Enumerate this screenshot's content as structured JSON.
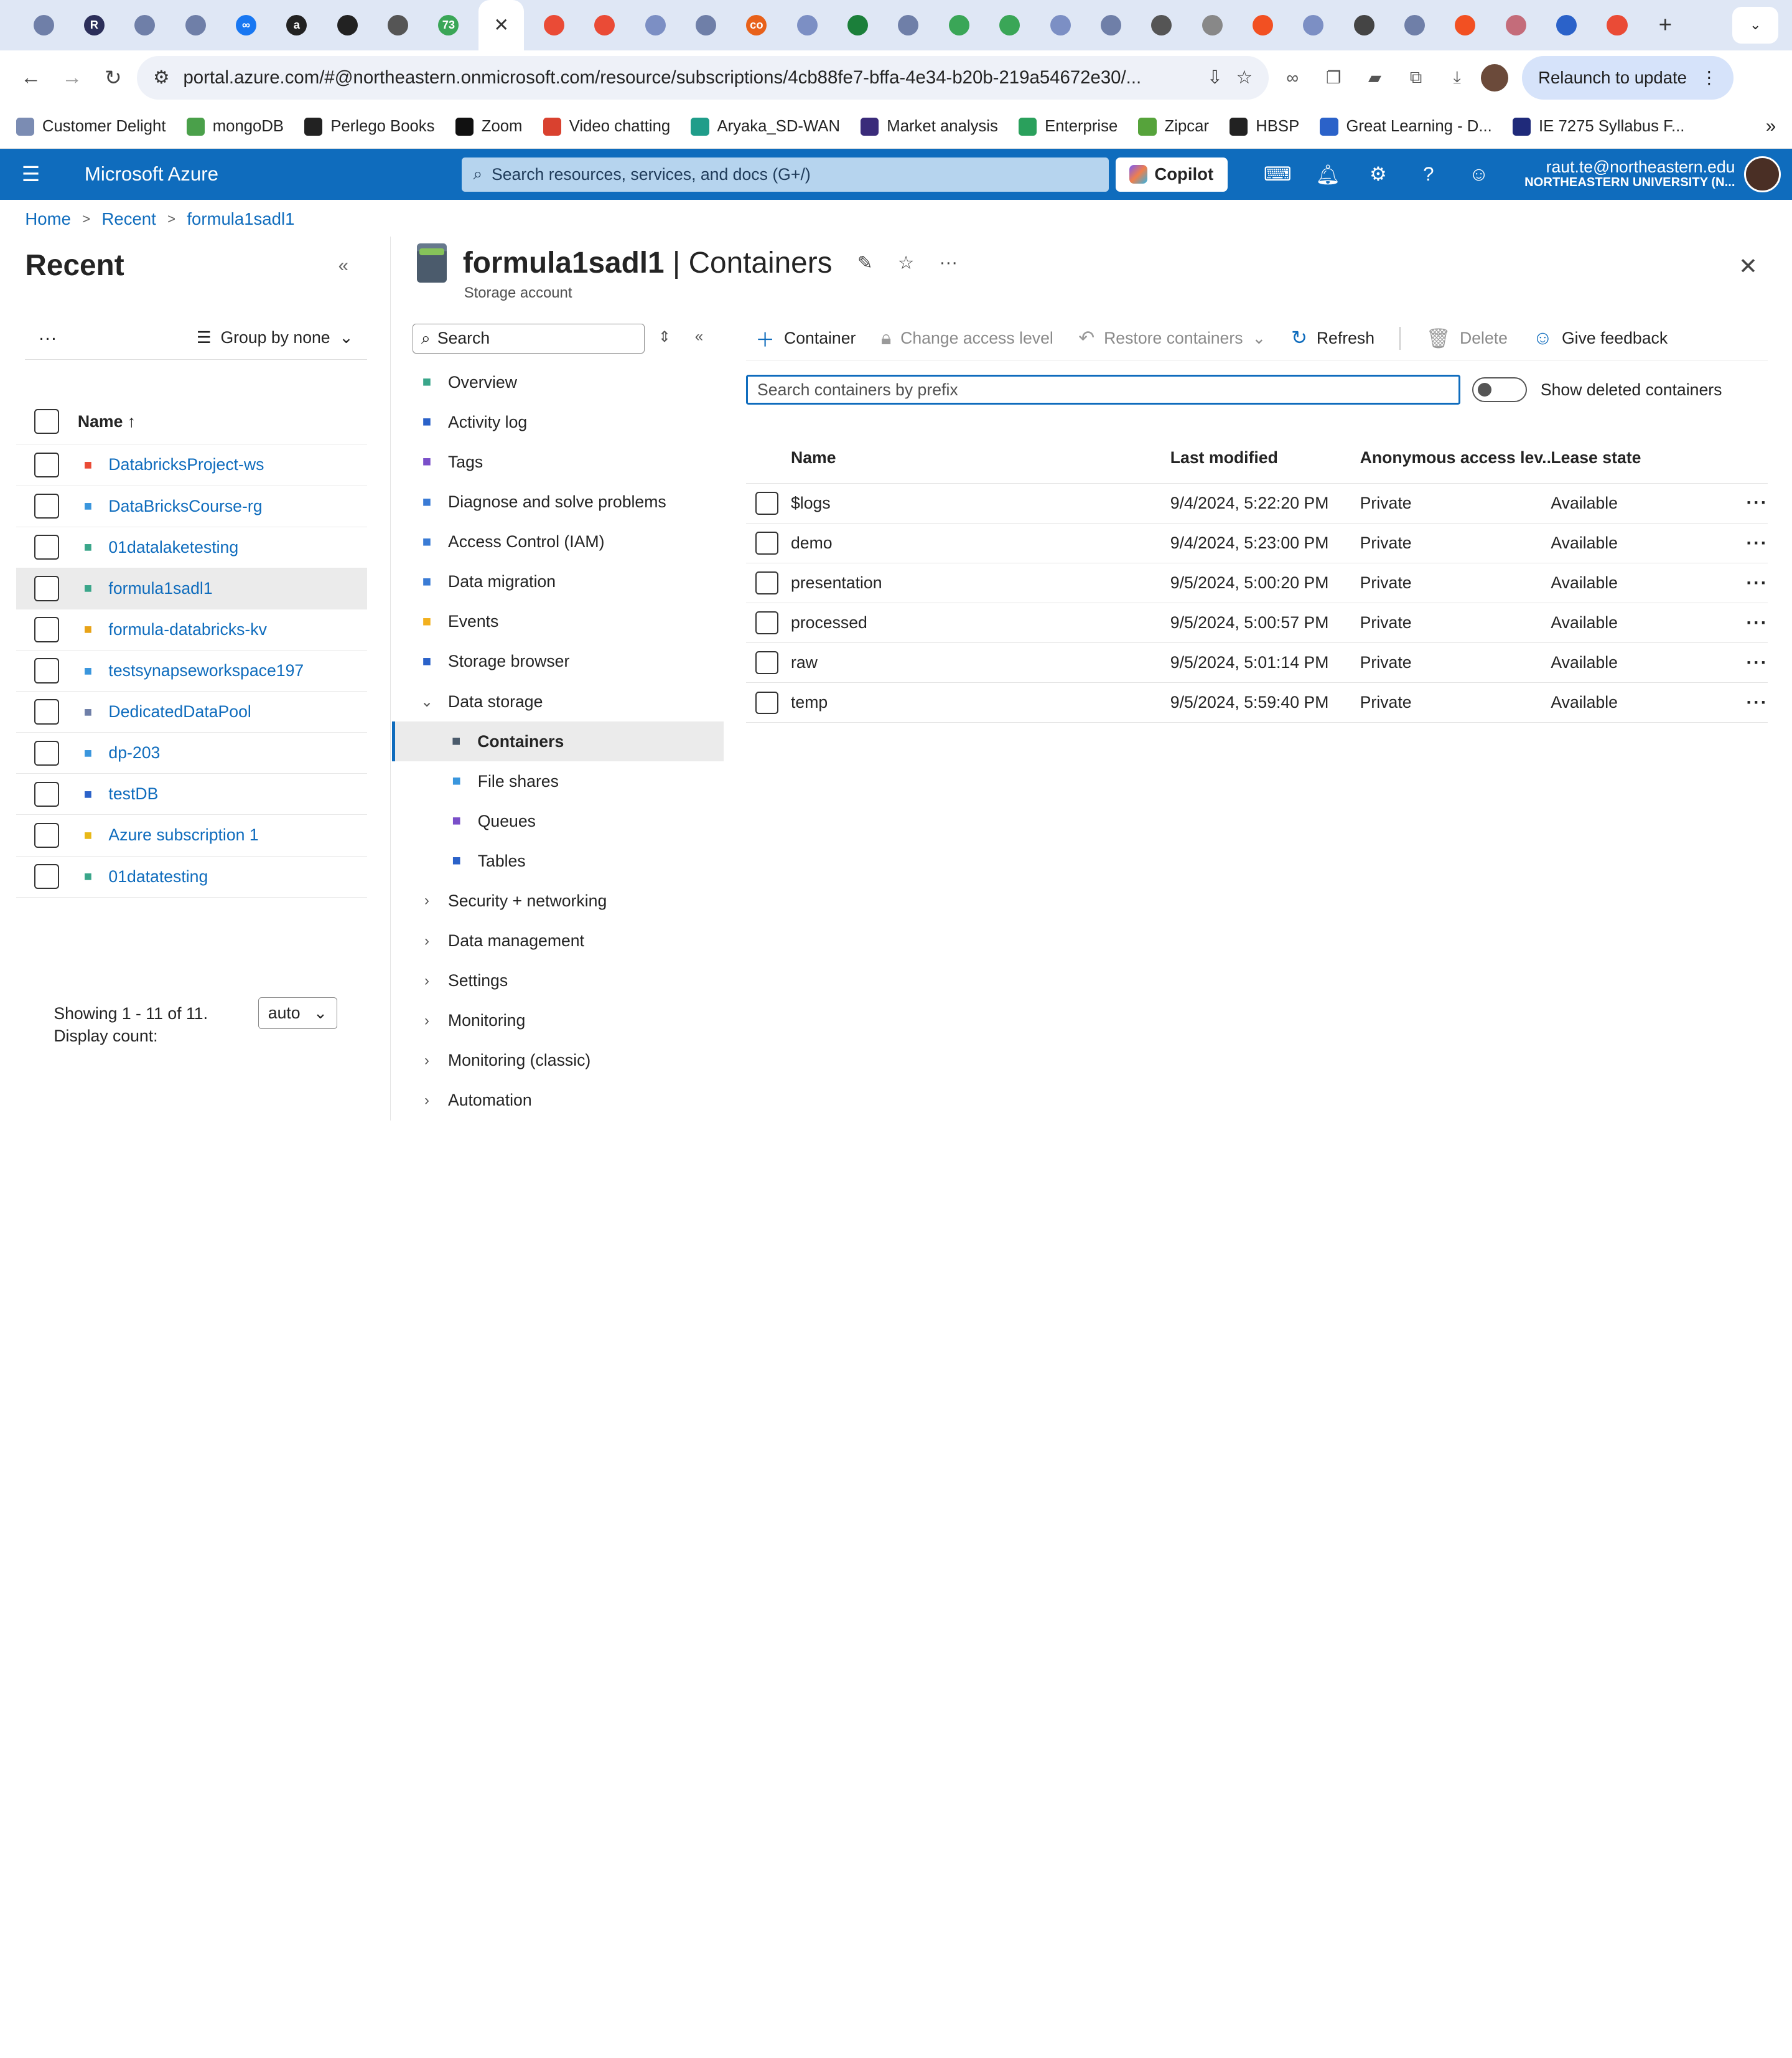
{
  "browser": {
    "tabs": [
      {
        "icon": "chrome-icon",
        "color": "#6f7fa8"
      },
      {
        "icon": "r-app-icon",
        "color": "#2c2f5a",
        "label": "R"
      },
      {
        "icon": "gear-badge-icon",
        "color": "#6f7fa8"
      },
      {
        "icon": "gear-badge-icon",
        "color": "#6f7fa8"
      },
      {
        "icon": "meta-icon",
        "color": "#1877f2",
        "label": "∞"
      },
      {
        "icon": "amazon-icon",
        "color": "#222222",
        "label": "a"
      },
      {
        "icon": "github-icon",
        "color": "#222222"
      },
      {
        "icon": "folder-icon",
        "color": "#555555"
      },
      {
        "icon": "green-badge-icon",
        "color": "#3aa657",
        "label": "73"
      },
      {
        "icon": "close-icon",
        "active": true
      },
      {
        "icon": "databricks-icon",
        "color": "#ea4b36"
      },
      {
        "icon": "databricks-icon",
        "color": "#ea4b36"
      },
      {
        "icon": "gemini-icon",
        "color": "#7c8fc4"
      },
      {
        "icon": "openai-icon",
        "color": "#6f7fa8"
      },
      {
        "icon": "coursera-icon",
        "color": "#e8611a",
        "label": "co"
      },
      {
        "icon": "gemini-icon",
        "color": "#7c8fc4"
      },
      {
        "icon": "sheet-icon",
        "color": "#1b7f3a"
      },
      {
        "icon": "openai-icon",
        "color": "#6f7fa8"
      },
      {
        "icon": "s-icon",
        "color": "#3aa657"
      },
      {
        "icon": "s-icon",
        "color": "#3aa657"
      },
      {
        "icon": "gemini-icon",
        "color": "#7c8fc4"
      },
      {
        "icon": "w-icon",
        "color": "#6f7fa8"
      },
      {
        "icon": "folder-icon",
        "color": "#555555"
      },
      {
        "icon": "google-icon",
        "color": "#888888"
      },
      {
        "icon": "microsoft-icon",
        "color": "#f25022"
      },
      {
        "icon": "gemini-icon",
        "color": "#7c8fc4"
      },
      {
        "icon": "chrome-icon",
        "color": "#444444"
      },
      {
        "icon": "openai-icon",
        "color": "#6f7fa8"
      },
      {
        "icon": "microsoft-icon",
        "color": "#f25022"
      },
      {
        "icon": "settings-badge-icon",
        "color": "#c46c7a"
      },
      {
        "icon": "history-icon",
        "color": "#2b62c9"
      },
      {
        "icon": "databricks-icon",
        "color": "#ea4b36"
      }
    ],
    "new_tab": "+",
    "url": "portal.azure.com/#@northeastern.onmicrosoft.com/resource/subscriptions/4cb88fe7-bffa-4e34-b20b-219a54672e30/...",
    "relaunch_label": "Relaunch to update",
    "bookmarks": [
      {
        "label": "Customer Delight",
        "color": "#7b8cb3"
      },
      {
        "label": "mongoDB",
        "color": "#4aa04a"
      },
      {
        "label": "Perlego Books",
        "color": "#222222"
      },
      {
        "label": "Zoom",
        "color": "#111111"
      },
      {
        "label": "Video chatting",
        "color": "#d9412f"
      },
      {
        "label": "Aryaka_SD-WAN",
        "color": "#1f9d8a"
      },
      {
        "label": "Market analysis",
        "color": "#3a2b7a"
      },
      {
        "label": "Enterprise",
        "color": "#2aa05c"
      },
      {
        "label": "Zipcar",
        "color": "#56a33b"
      },
      {
        "label": "HBSP",
        "color": "#222222"
      },
      {
        "label": "Great Learning - D...",
        "color": "#2b62c9"
      },
      {
        "label": "IE 7275 Syllabus F...",
        "color": "#1f2a7a"
      }
    ]
  },
  "azure": {
    "brand": "Microsoft Azure",
    "search_placeholder": "Search resources, services, and docs (G+/)",
    "copilot_label": "Copilot",
    "user_email": "raut.te@northeastern.edu",
    "user_org": "NORTHEASTERN UNIVERSITY (N...",
    "accent": "#0f6cbd"
  },
  "breadcrumb": [
    "Home",
    "Recent",
    "formula1sadl1"
  ],
  "recent": {
    "title": "Recent",
    "more": "...",
    "group_by": "Group by none",
    "name_header": "Name ↑",
    "items": [
      {
        "name": "DatabricksProject-ws",
        "icon": "databricks-icon",
        "color": "#ea4b36",
        "selected": false
      },
      {
        "name": "DataBricksCourse-rg",
        "icon": "resource-group-icon",
        "color": "#3a96dd",
        "selected": false
      },
      {
        "name": "01datalaketesting",
        "icon": "storage-account-icon",
        "color": "#3aa68a",
        "selected": false
      },
      {
        "name": "formula1sadl1",
        "icon": "storage-account-icon",
        "color": "#3aa68a",
        "selected": true
      },
      {
        "name": "formula-databricks-kv",
        "icon": "key-vault-icon",
        "color": "#e8a317",
        "selected": false
      },
      {
        "name": "testsynapseworkspace197",
        "icon": "synapse-icon",
        "color": "#3a96dd",
        "selected": false
      },
      {
        "name": "DedicatedDataPool",
        "icon": "sql-pool-icon",
        "color": "#6f7fa8",
        "selected": false
      },
      {
        "name": "dp-203",
        "icon": "resource-group-icon",
        "color": "#3a96dd",
        "selected": false
      },
      {
        "name": "testDB",
        "icon": "sql-database-icon",
        "color": "#2b62c9",
        "selected": false
      },
      {
        "name": "Azure subscription 1",
        "icon": "subscription-key-icon",
        "color": "#e8b817",
        "selected": false
      },
      {
        "name": "01datatesting",
        "icon": "storage-account-icon",
        "color": "#3aa68a",
        "selected": false
      }
    ],
    "showing": "Showing 1 - 11 of 11.",
    "display_count_label": "Display count:",
    "display_count_value": "auto"
  },
  "resource": {
    "name": "formula1sadl1",
    "section": "Containers",
    "type": "Storage account",
    "menu_search_placeholder": "Search",
    "menu": [
      {
        "label": "Overview",
        "icon": "overview-icon",
        "color": "#3aa68a",
        "level": 0
      },
      {
        "label": "Activity log",
        "icon": "activity-log-icon",
        "color": "#2b62c9",
        "level": 0
      },
      {
        "label": "Tags",
        "icon": "tag-icon",
        "color": "#7a4fc9",
        "level": 0
      },
      {
        "label": "Diagnose and solve problems",
        "icon": "wrench-icon",
        "color": "#3a7bd5",
        "level": 0
      },
      {
        "label": "Access Control (IAM)",
        "icon": "people-icon",
        "color": "#3a7bd5",
        "level": 0
      },
      {
        "label": "Data migration",
        "icon": "migration-icon",
        "color": "#3a7bd5",
        "level": 0
      },
      {
        "label": "Events",
        "icon": "lightning-icon",
        "color": "#f2b01e",
        "level": 0
      },
      {
        "label": "Storage browser",
        "icon": "storage-browser-icon",
        "color": "#2b62c9",
        "level": 0
      },
      {
        "label": "Data storage",
        "icon": "chevron-down-icon",
        "color": "#555555",
        "level": 0,
        "group": true,
        "expanded": true
      },
      {
        "label": "Containers",
        "icon": "container-icon",
        "color": "#4b5b6c",
        "level": 1,
        "selected": true
      },
      {
        "label": "File shares",
        "icon": "file-share-icon",
        "color": "#3a96dd",
        "level": 1
      },
      {
        "label": "Queues",
        "icon": "queue-icon",
        "color": "#7a4fc9",
        "level": 1
      },
      {
        "label": "Tables",
        "icon": "table-icon",
        "color": "#2b62c9",
        "level": 1
      },
      {
        "label": "Security + networking",
        "icon": "chevron-right-icon",
        "color": "#555555",
        "level": 0,
        "group": true
      },
      {
        "label": "Data management",
        "icon": "chevron-right-icon",
        "color": "#555555",
        "level": 0,
        "group": true
      },
      {
        "label": "Settings",
        "icon": "chevron-right-icon",
        "color": "#555555",
        "level": 0,
        "group": true
      },
      {
        "label": "Monitoring",
        "icon": "chevron-right-icon",
        "color": "#555555",
        "level": 0,
        "group": true
      },
      {
        "label": "Monitoring (classic)",
        "icon": "chevron-right-icon",
        "color": "#555555",
        "level": 0,
        "group": true
      },
      {
        "label": "Automation",
        "icon": "chevron-right-icon",
        "color": "#555555",
        "level": 0,
        "group": true
      }
    ]
  },
  "toolbar": {
    "add_container": "Container",
    "change_access": "Change access level",
    "restore": "Restore containers",
    "refresh": "Refresh",
    "delete": "Delete",
    "feedback": "Give feedback"
  },
  "filter": {
    "prefix_placeholder": "Search containers by prefix",
    "show_deleted_label": "Show deleted containers",
    "show_deleted": false
  },
  "containers": {
    "columns": [
      "Name",
      "Last modified",
      "Anonymous access lev...",
      "Lease state"
    ],
    "rows": [
      {
        "name": "$logs",
        "modified": "9/4/2024, 5:22:20 PM",
        "access": "Private",
        "lease": "Available"
      },
      {
        "name": "demo",
        "modified": "9/4/2024, 5:23:00 PM",
        "access": "Private",
        "lease": "Available"
      },
      {
        "name": "presentation",
        "modified": "9/5/2024, 5:00:20 PM",
        "access": "Private",
        "lease": "Available"
      },
      {
        "name": "processed",
        "modified": "9/5/2024, 5:00:57 PM",
        "access": "Private",
        "lease": "Available"
      },
      {
        "name": "raw",
        "modified": "9/5/2024, 5:01:14 PM",
        "access": "Private",
        "lease": "Available"
      },
      {
        "name": "temp",
        "modified": "9/5/2024, 5:59:40 PM",
        "access": "Private",
        "lease": "Available"
      }
    ]
  }
}
